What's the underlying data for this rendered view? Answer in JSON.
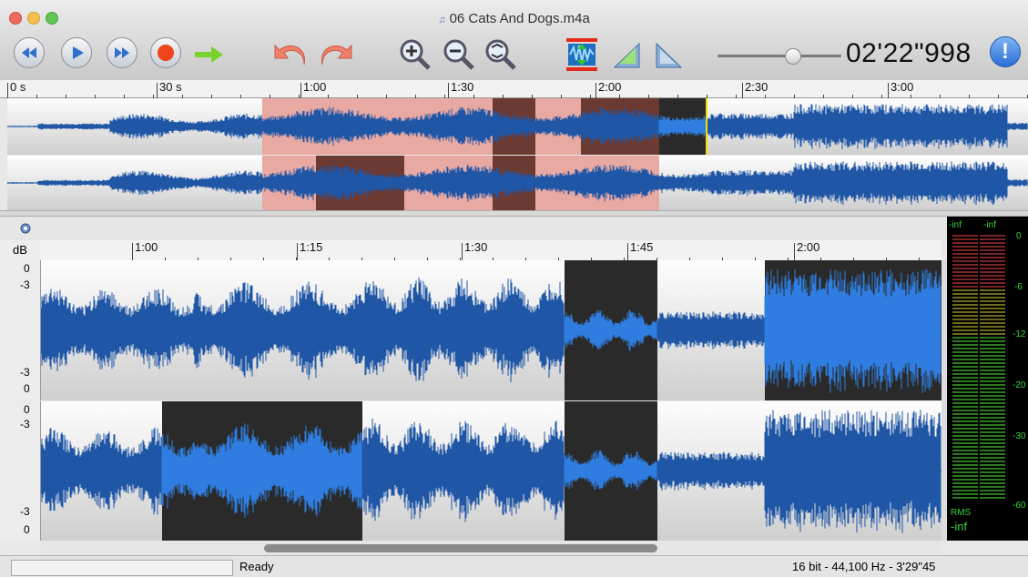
{
  "window": {
    "title": "06 Cats And Dogs.m4a",
    "traffic_lights": [
      "#ed6a5f",
      "#f5bf4f",
      "#61c554"
    ]
  },
  "toolbar": {
    "buttons": [
      {
        "name": "rewind-button",
        "icon": "rewind-icon"
      },
      {
        "name": "play-button",
        "icon": "play-icon"
      },
      {
        "name": "fast-forward-button",
        "icon": "fast-forward-icon"
      },
      {
        "name": "record-button",
        "icon": "record-icon"
      },
      {
        "name": "go-to-button",
        "icon": "arrow-right-icon"
      },
      {
        "name": "undo-button",
        "icon": "undo-icon"
      },
      {
        "name": "redo-button",
        "icon": "redo-icon"
      },
      {
        "name": "zoom-in-button",
        "icon": "zoom-in-icon"
      },
      {
        "name": "zoom-out-button",
        "icon": "zoom-out-icon"
      },
      {
        "name": "zoom-fit-button",
        "icon": "zoom-fit-icon"
      },
      {
        "name": "amplify-button",
        "icon": "amplify-icon"
      },
      {
        "name": "fade-in-button",
        "icon": "fade-in-icon"
      },
      {
        "name": "fade-out-button",
        "icon": "fade-out-icon"
      }
    ],
    "playback_position": 0.6,
    "timecode": "02'22\"998",
    "info_label": "!"
  },
  "overview": {
    "ruler_labels": [
      "0 s",
      "30 s",
      "1:00",
      "1:30",
      "2:00",
      "2:30",
      "3:00"
    ]
  },
  "detail": {
    "db_header": "dB",
    "ruler_labels": [
      "1:00",
      "1:15",
      "1:30",
      "1:45",
      "2:00"
    ],
    "channel_top_labels": [
      "0",
      "-3"
    ],
    "channel_bottom_labels": [
      "-3",
      "0"
    ]
  },
  "meters": {
    "peak_left": "-inf",
    "peak_right": "-inf",
    "scale": [
      "0",
      "-6",
      "-12",
      "-20",
      "-30",
      "-60"
    ],
    "rms_label": "RMS",
    "rms_value": "-inf"
  },
  "status": {
    "text": "Ready",
    "format": "16 bit - 44,100 Hz - 3'29\"45"
  },
  "colors": {
    "wave": "#1f56a6",
    "wave_selected": "#2f7de0",
    "selection": "#e9a9a3",
    "dark_region": "#2a2a2a",
    "meter_green": "#39d43a",
    "playhead": "#f2e100"
  }
}
